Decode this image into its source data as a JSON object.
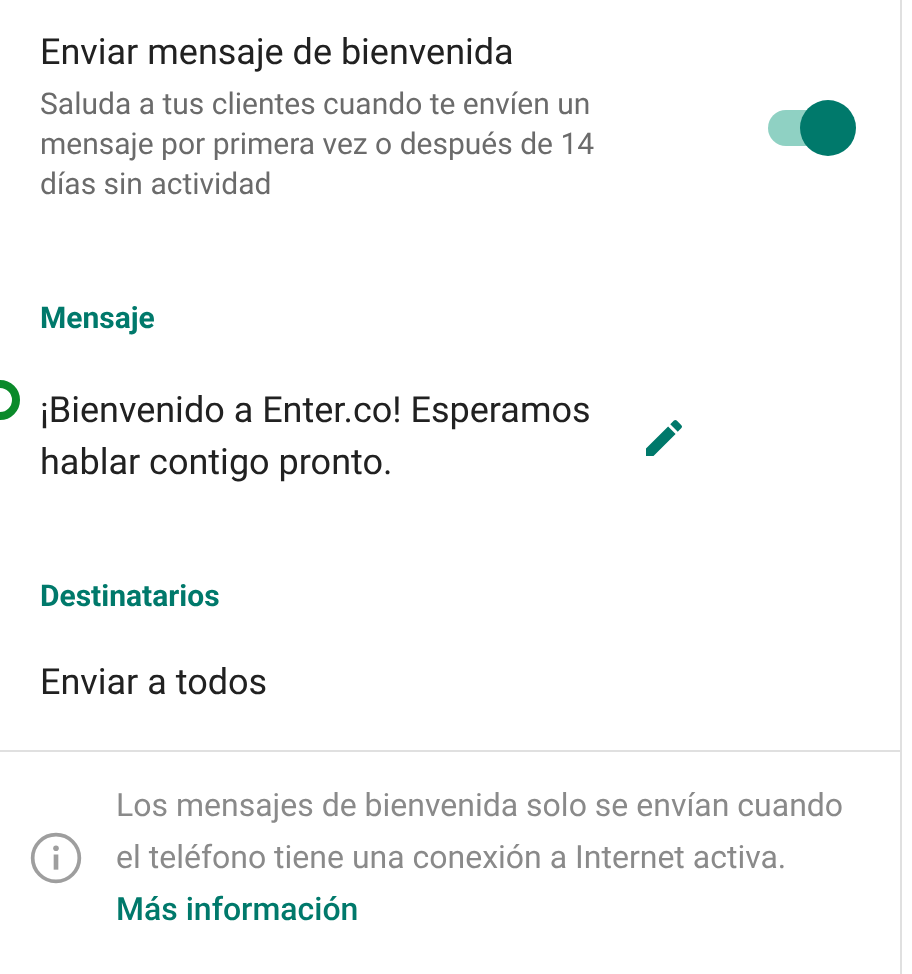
{
  "welcome": {
    "title": "Enviar mensaje de bienvenida",
    "description": "Saluda a tus clientes cuando te envíen un mensaje por primera vez o después de 14 días sin actividad",
    "on": true
  },
  "message": {
    "heading": "Mensaje",
    "text": "¡Bienvenido a Enter.co! Esperamos hablar contigo pronto."
  },
  "recipients": {
    "heading": "Destinatarios",
    "value": "Enviar a todos"
  },
  "footer": {
    "text": "Los mensajes de bienvenida solo se envían cuando el teléfono tiene una conexión a Internet activa.",
    "link": "Más información"
  }
}
